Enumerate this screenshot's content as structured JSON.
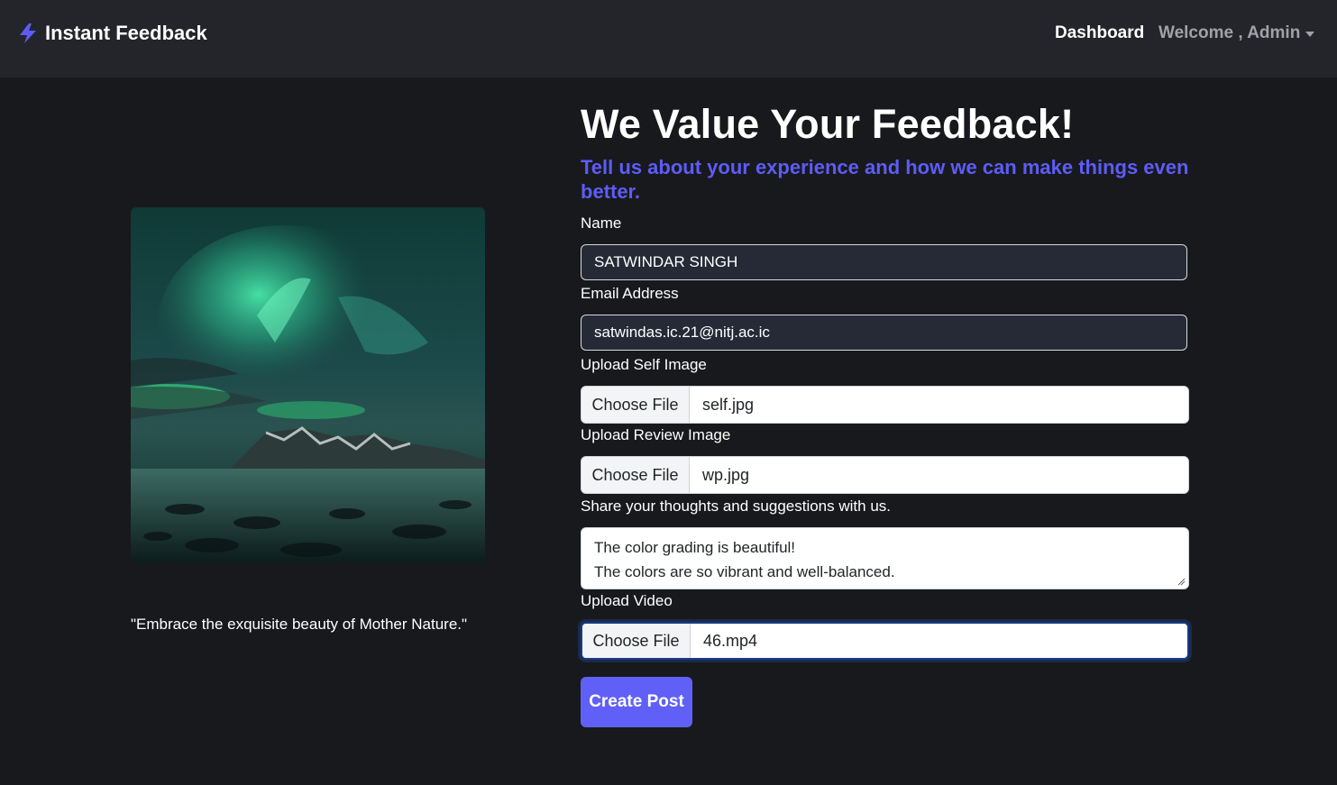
{
  "navbar": {
    "brand": "Instant Feedback",
    "brand_icon": "lightning-bolt-icon",
    "dashboard": "Dashboard",
    "welcome": "Welcome , Admin",
    "accent": "#5d5cf6"
  },
  "left": {
    "image_alt": "aurora landscape",
    "quote": "\"Embrace the exquisite beauty of Mother Nature.\""
  },
  "form": {
    "title": "We Value Your Feedback!",
    "subtitle": "Tell us about your experience and how we can make things even better.",
    "name_label": "Name",
    "name_value": "SATWINDAR SINGH",
    "email_label": "Email Address",
    "email_value": "satwindas.ic.21@nitj.ac.ic",
    "self_image_label": "Upload Self Image",
    "self_image_button": "Choose File",
    "self_image_file": "self.jpg",
    "review_image_label": "Upload Review Image",
    "review_image_button": "Choose File",
    "review_image_file": "wp.jpg",
    "thoughts_label": "Share your thoughts and suggestions with us.",
    "thoughts_line1": "The color grading is beautiful!",
    "thoughts_line2": "The colors are so vibrant and well-balanced.",
    "video_label": "Upload Video",
    "video_button": "Choose File",
    "video_file": "46.mp4",
    "submit": "Create Post"
  }
}
